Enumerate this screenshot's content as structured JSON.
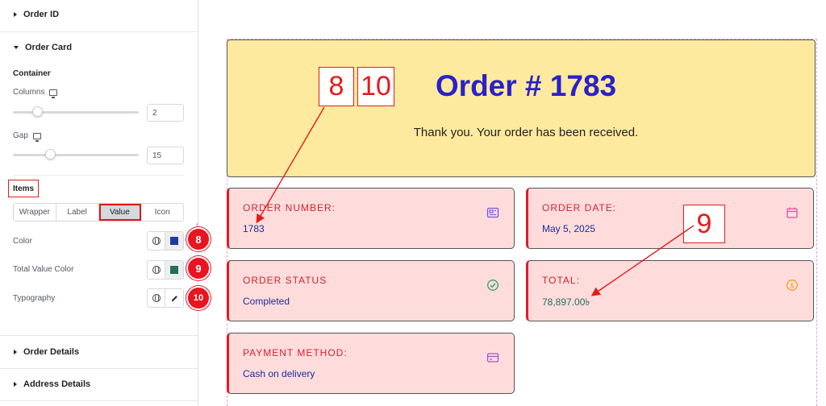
{
  "sidebar": {
    "order_id": "Order ID",
    "order_card": "Order Card",
    "container": "Container",
    "columns_label": "Columns",
    "columns_value": "2",
    "gap_label": "Gap",
    "gap_value": "15",
    "items": "Items",
    "tabs": [
      "Wrapper",
      "Label",
      "Value",
      "Icon"
    ],
    "active_tab": "Value",
    "color_label": "Color",
    "total_value_color_label": "Total Value Color",
    "typography_label": "Typography",
    "color_swatch": "#1f3c9a",
    "total_color_swatch": "#1f6f5c",
    "order_details": "Order Details",
    "address_details": "Address Details",
    "badges": [
      "8",
      "9",
      "10"
    ]
  },
  "preview": {
    "title": "Order # 1783",
    "thanks": "Thank you. Your order has been received.",
    "cards": [
      {
        "label": "ORDER NUMBER:",
        "value": "1783",
        "icon": "receipt-icon",
        "icon_color": "#6a5be0"
      },
      {
        "label": "ORDER DATE:",
        "value": "May 5, 2025",
        "icon": "calendar-icon",
        "icon_color": "#e54ea3"
      },
      {
        "label": "ORDER STATUS",
        "value": "Completed",
        "icon": "check-circle-icon",
        "icon_color": "#2ea36b"
      },
      {
        "label": "TOTAL:",
        "value": "78,897.00৳",
        "icon": "dollar-coin-icon",
        "icon_color": "#f0a020"
      },
      {
        "label": "PAYMENT METHOD:",
        "value": "Cash on delivery",
        "icon": "credit-card-icon",
        "icon_color": "#9b59d6"
      }
    ],
    "callouts": [
      "8",
      "10",
      "9"
    ]
  },
  "colors": {
    "accent_red": "#e61a1a",
    "title_blue": "#2a21c9",
    "total_green": "#1f6f5c"
  }
}
